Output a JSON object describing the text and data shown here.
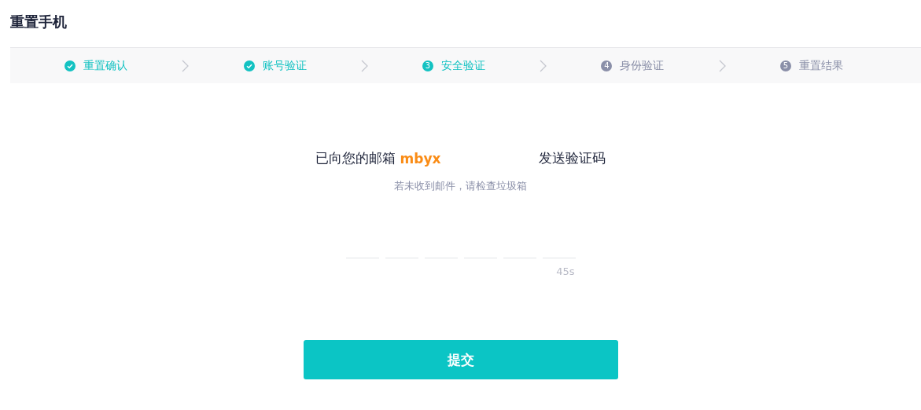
{
  "page": {
    "title": "重置手机"
  },
  "steps": [
    {
      "label": "重置确认",
      "kind": "done"
    },
    {
      "label": "账号验证",
      "kind": "done"
    },
    {
      "label": "安全验证",
      "number": "3",
      "kind": "current"
    },
    {
      "label": "身份验证",
      "number": "4",
      "kind": "pending"
    },
    {
      "label": "重置结果",
      "number": "5",
      "kind": "pending"
    }
  ],
  "message": {
    "prefix": "已向您的邮箱",
    "email": "mbyx",
    "suffix": "发送验证码"
  },
  "hint": "若未收到邮件，请检查垃圾箱",
  "code_digits": [
    {
      "filled": false
    },
    {
      "filled": false
    },
    {
      "filled": false
    },
    {
      "filled": false
    },
    {
      "filled": false
    },
    {
      "filled": false
    }
  ],
  "countdown": "45s",
  "submit_button": "提交"
}
